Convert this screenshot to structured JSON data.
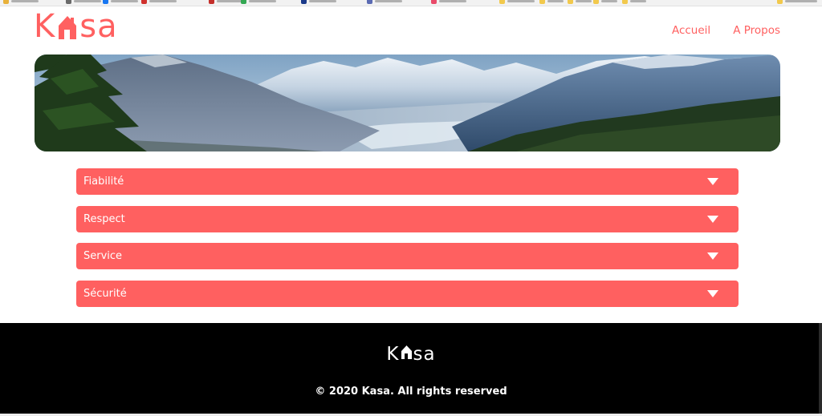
{
  "header": {
    "logo": {
      "k": "K",
      "rest": "sa"
    },
    "nav": [
      {
        "label": "Accueil"
      },
      {
        "label": "A Propos"
      }
    ]
  },
  "accordion": [
    {
      "label": "Fiabilité"
    },
    {
      "label": "Respect"
    },
    {
      "label": "Service"
    },
    {
      "label": "Sécurité"
    }
  ],
  "footer": {
    "logo": {
      "k": "K",
      "rest": "sa"
    },
    "copyright": "© 2020 Kasa. All rights reserved"
  },
  "colors": {
    "brand": "#ff6060",
    "footer_bg": "#000000",
    "text_on_brand": "#ffffff"
  },
  "icons": [
    "house-icon",
    "chevron-down-icon"
  ]
}
